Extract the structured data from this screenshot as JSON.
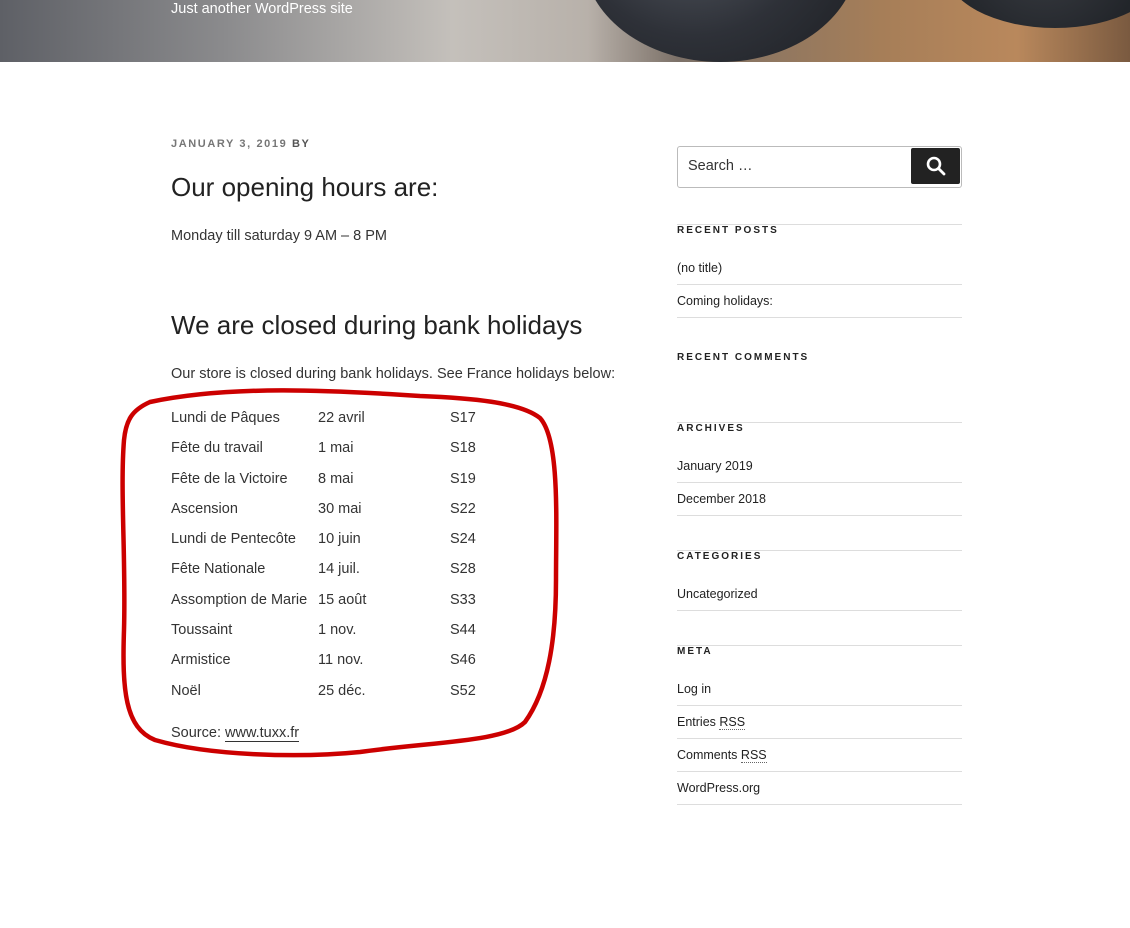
{
  "site": {
    "tagline": "Just another WordPress site"
  },
  "post": {
    "date": "JANUARY 3, 2019",
    "by": "BY",
    "title": "Our opening hours are:",
    "hours": "Monday till saturday 9 AM – 8 PM",
    "heading2": "We are closed during bank holidays",
    "intro": "Our store is closed during bank holidays. See France holidays below:",
    "holidays": [
      {
        "name": "Lundi de Pâques",
        "date": "22 avril",
        "week": "S17"
      },
      {
        "name": "Fête du travail",
        "date": "1 mai",
        "week": "S18"
      },
      {
        "name": "Fête de la Victoire",
        "date": "8 mai",
        "week": "S19"
      },
      {
        "name": "Ascension",
        "date": "30 mai",
        "week": "S22"
      },
      {
        "name": "Lundi de Pentecôte",
        "date": "10 juin",
        "week": "S24"
      },
      {
        "name": "Fête Nationale",
        "date": "14 juil.",
        "week": "S28"
      },
      {
        "name": "Assomption de Marie",
        "date": "15 août",
        "week": "S33"
      },
      {
        "name": "Toussaint",
        "date": "1 nov.",
        "week": "S44"
      },
      {
        "name": "Armistice",
        "date": "11 nov.",
        "week": "S46"
      },
      {
        "name": "Noël",
        "date": "25 déc.",
        "week": "S52"
      }
    ],
    "source_label": "Source:",
    "source_link": "www.tuxx.fr"
  },
  "sidebar": {
    "search": {
      "placeholder": "Search …",
      "icon": "search-icon"
    },
    "recent_posts": {
      "title": "RECENT POSTS",
      "items": [
        "(no title)",
        "Coming holidays:"
      ]
    },
    "recent_comments": {
      "title": "RECENT COMMENTS"
    },
    "archives": {
      "title": "ARCHIVES",
      "items": [
        "January 2019",
        "December 2018"
      ]
    },
    "categories": {
      "title": "CATEGORIES",
      "items": [
        "Uncategorized"
      ]
    },
    "meta": {
      "title": "META",
      "login": "Log in",
      "entries_prefix": "Entries",
      "comments_prefix": "Comments",
      "rss": "RSS",
      "wordpress": "WordPress.org"
    }
  },
  "annotation_color": "#cc0000"
}
